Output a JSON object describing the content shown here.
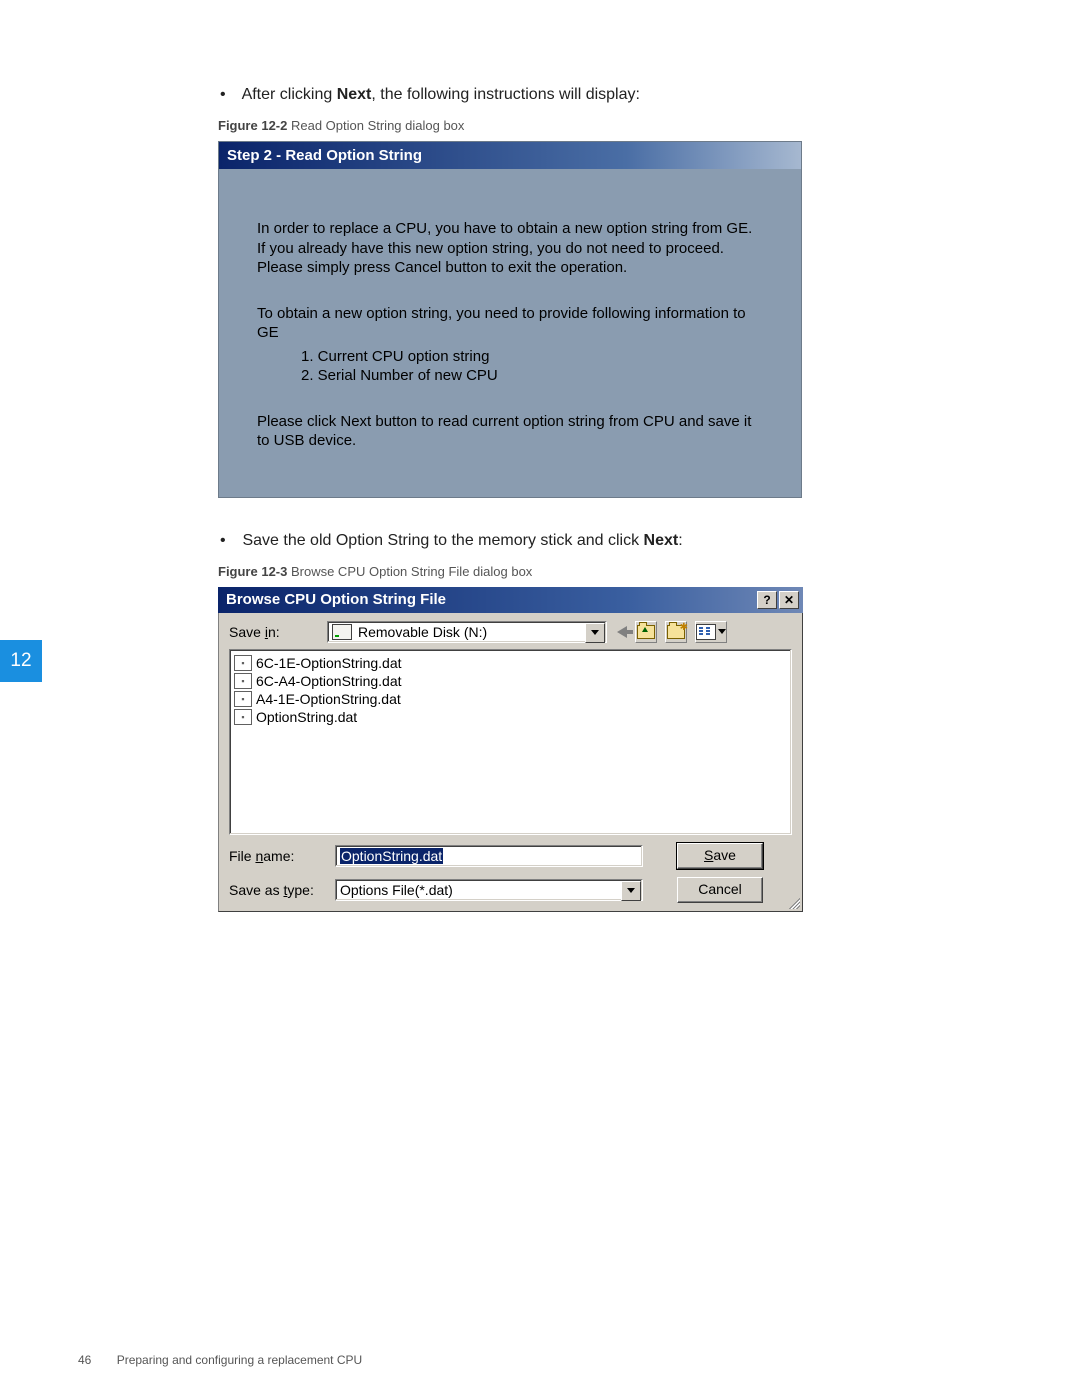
{
  "intro1": {
    "pre": "After clicking ",
    "bold": "Next",
    "post": ", the following instructions will display:"
  },
  "caption1": {
    "bold": "Figure 12-2",
    "rest": "  Read Option String dialog box"
  },
  "dialog1": {
    "title": "Step 2 - Read Option String",
    "para1": "In order to replace a CPU, you have to obtain a new option string from GE. If you already have this new option string, you do not need to proceed. Please simply press Cancel button to exit the operation.",
    "para2": "To obtain a new option string, you need to provide following information to GE",
    "li1": "1. Current CPU option string",
    "li2": "2. Serial Number of new CPU",
    "para3": "Please click Next button to read current option string from CPU and save it to USB device."
  },
  "intro2": {
    "pre": "Save the old Option String to the memory stick and click ",
    "bold": "Next",
    "post": ":"
  },
  "caption2": {
    "bold": "Figure 12-3",
    "rest": "  Browse CPU Option String File dialog box"
  },
  "dialog2": {
    "title": "Browse CPU Option String File",
    "savein_label_pre": "Save ",
    "savein_label_u": "i",
    "savein_label_post": "n:",
    "savein_value": "Removable Disk (N:)",
    "files": [
      "6C-1E-OptionString.dat",
      "6C-A4-OptionString.dat",
      "A4-1E-OptionString.dat",
      "OptionString.dat"
    ],
    "filename_label_pre": "File ",
    "filename_label_u": "n",
    "filename_label_post": "ame:",
    "filename_value": "OptionString.dat",
    "type_label_pre": "Save as ",
    "type_label_u": "t",
    "type_label_post": "ype:",
    "type_value": "Options File(*.dat)",
    "save_u": "S",
    "save_rest": "ave",
    "cancel": "Cancel"
  },
  "side_tab": "12",
  "footer_page": "46",
  "footer_text": "Preparing and configuring a replacement CPU"
}
